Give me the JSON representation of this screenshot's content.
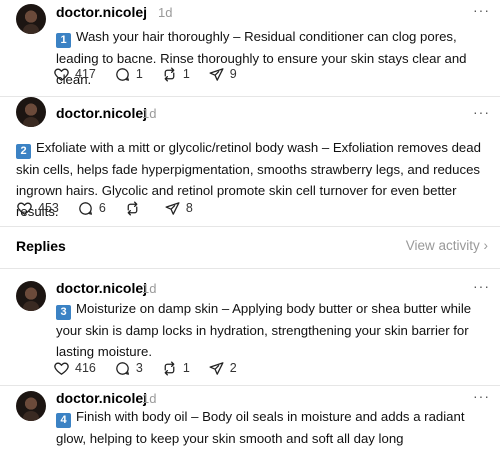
{
  "posts": [
    {
      "username": "doctor.nicolej",
      "time": "1d",
      "number": "1",
      "text": "Wash your hair thoroughly – Residual conditioner can clog pores, leading to bacne. Rinse thoroughly to ensure your skin stays clear and clean.",
      "likes": "417",
      "comments": "1",
      "reposts": "1",
      "shares": "9"
    },
    {
      "username": "doctor.nicolej",
      "time": "1d",
      "number": "2",
      "text": "Exfoliate with a mitt or glycolic/retinol body wash – Exfoliation removes dead skin cells, helps fade hyperpigmentation, smooths strawberry legs, and reduces ingrown hairs. Glycolic and retinol promote skin cell turnover for even better results.",
      "likes": "453",
      "comments": "6",
      "reposts": "",
      "shares": "8"
    },
    {
      "username": "doctor.nicolej",
      "time": "1d",
      "number": "3",
      "text": "Moisturize on damp skin – Applying body butter or shea butter while your skin is damp locks in hydration, strengthening your skin barrier for lasting moisture.",
      "likes": "416",
      "comments": "3",
      "reposts": "1",
      "shares": "2"
    },
    {
      "username": "doctor.nicolej",
      "time": "1d",
      "number": "4",
      "text": "Finish with body oil – Body oil seals in moisture and adds a radiant glow, helping to keep your skin smooth and soft all day long"
    }
  ],
  "replies": {
    "label": "Replies",
    "view_activity": "View activity ›"
  },
  "more_label": "···",
  "icons": {
    "like": "heart-icon",
    "comment": "comment-icon",
    "repost": "repost-icon",
    "share": "send-icon"
  },
  "colors": {
    "number_badge": "#3b82c4",
    "muted": "#999999"
  }
}
